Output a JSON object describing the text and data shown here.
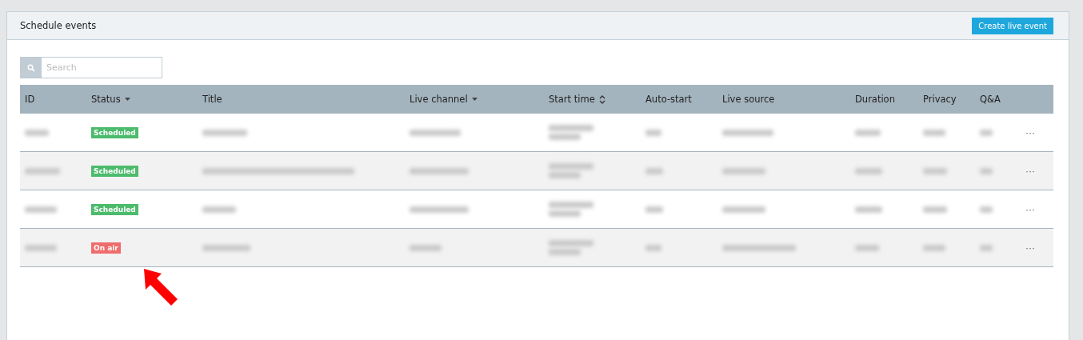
{
  "panel": {
    "title": "Schedule events",
    "button": "Create live event"
  },
  "search": {
    "placeholder": "Search"
  },
  "table": {
    "columns": [
      {
        "label": "ID"
      },
      {
        "label": "Status",
        "kind": "sort-down"
      },
      {
        "label": "Title"
      },
      {
        "label": "Live channel",
        "kind": "sort-down"
      },
      {
        "label": "Start time",
        "kind": "sort-both"
      },
      {
        "label": "Auto-start"
      },
      {
        "label": "Live source"
      },
      {
        "label": "Duration"
      },
      {
        "label": "Privacy"
      },
      {
        "label": "Q&A"
      }
    ],
    "rows": [
      {
        "status": "Scheduled",
        "kind": "scheduled",
        "more": "···"
      },
      {
        "status": "Scheduled",
        "kind": "scheduled",
        "more": "···"
      },
      {
        "status": "Scheduled",
        "kind": "scheduled",
        "more": "···"
      },
      {
        "status": "On air",
        "kind": "on-air",
        "more": "···"
      }
    ]
  }
}
